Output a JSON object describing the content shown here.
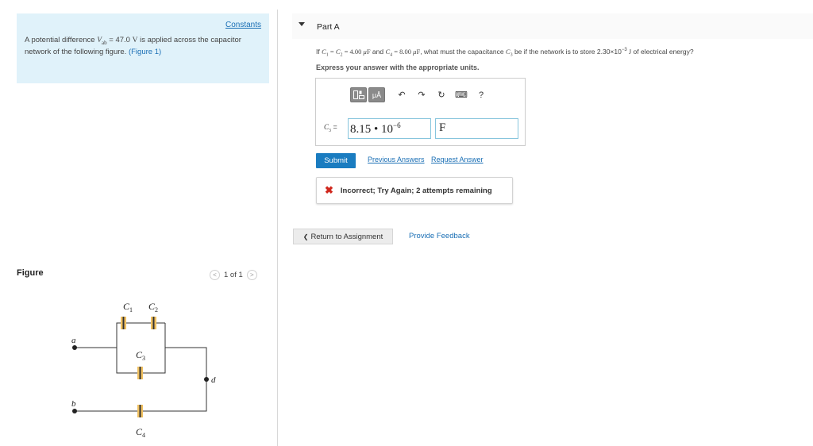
{
  "left": {
    "constants_label": "Constants",
    "problem_pre": "A potential difference ",
    "problem_var": "V",
    "problem_var_sub": "ab",
    "problem_eq": " = 47.0 ",
    "problem_unit": "V",
    "problem_post": " is applied across the capacitor network of the following figure. ",
    "figure_link": "(Figure 1)",
    "figure_heading": "Figure",
    "pager_text": "1 of 1",
    "circuit": {
      "c1": "C",
      "c1_sub": "1",
      "c2": "C",
      "c2_sub": "2",
      "c3": "C",
      "c3_sub": "3",
      "c4": "C",
      "c4_sub": "4",
      "node_a": "a",
      "node_b": "b",
      "node_d": "d"
    }
  },
  "part": {
    "title": "Part A",
    "q_if": "If ",
    "q_c1": "C",
    "q_c1_sub": "1",
    "q_eq1": " = ",
    "q_c2": "C",
    "q_c2_sub": "2",
    "q_eq2": " = 4.00 ",
    "q_mu1": "μ",
    "q_f1": "F",
    "q_and": " and ",
    "q_c4": "C",
    "q_c4_sub": "4",
    "q_eq3": " = 8.00 ",
    "q_mu2": "μ",
    "q_f2": "F",
    "q_what": ", what must the capacitance ",
    "q_c3": "C",
    "q_c3_sub": "3",
    "q_store": " be if the network is to store 2.30×10",
    "q_exp": "−3",
    "q_j": " J",
    "q_end": " of electrical energy?",
    "instruction": "Express your answer with the appropriate units."
  },
  "answer": {
    "label_var": "C",
    "label_sub": "3",
    "label_eq": " = ",
    "value_mantissa": "8.15 • 10",
    "value_exp": "−6",
    "unit": "F",
    "tools": {
      "templates_icon": "templates-icon",
      "units_label": "μÅ",
      "undo_glyph": "↶",
      "redo_glyph": "↷",
      "reset_glyph": "↻",
      "keyboard_glyph": "⌨",
      "help_glyph": "?"
    }
  },
  "actions": {
    "submit": "Submit",
    "previous_answers": "Previous Answers",
    "request_answer": "Request Answer"
  },
  "feedback": {
    "icon": "✖",
    "text": "Incorrect; Try Again; 2 attempts remaining"
  },
  "footer": {
    "return_label": "Return to Assignment",
    "return_chevron": "❮",
    "provide_feedback": "Provide Feedback"
  },
  "colors": {
    "accent": "#1a7cc0",
    "link": "#1a6fb5",
    "error": "#d0271d",
    "problem_bg": "#e0f2fa",
    "capacitor_plate": "#f0c060"
  }
}
